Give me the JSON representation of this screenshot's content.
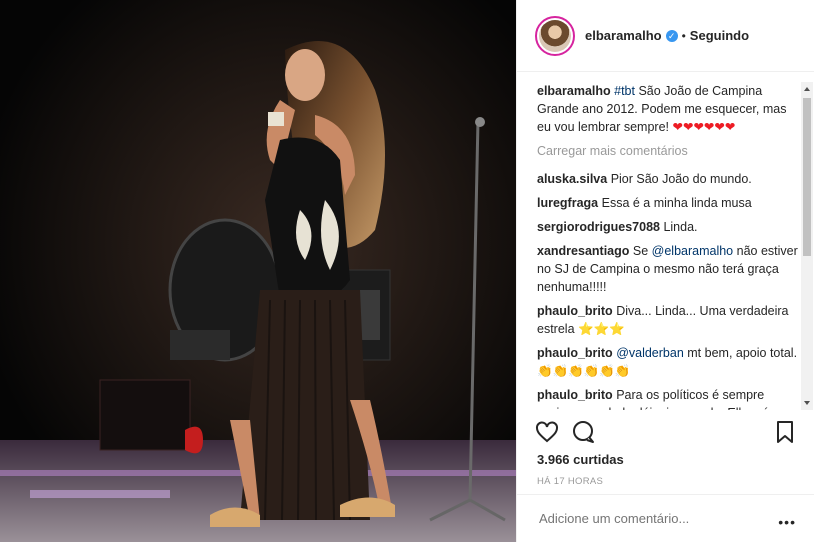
{
  "post": {
    "username": "elbaramalho",
    "verified_icon": "verified-badge-icon",
    "separator": "•",
    "follow_status": "Seguindo"
  },
  "caption": {
    "username": "elbaramalho",
    "hashtag": "#tbt",
    "text": "São João de Campina Grande ano 2012. Podem me esquecer, mas eu vou lembrar sempre!",
    "emoji": "❤❤❤❤❤❤"
  },
  "load_more": "Carregar mais comentários",
  "comments": [
    {
      "user": "aluska.silva",
      "pre": "",
      "mention": "",
      "text": "Pior São João do mundo."
    },
    {
      "user": "luregfraga",
      "pre": "",
      "mention": "",
      "text": "Essa é a minha linda musa"
    },
    {
      "user": "sergiorodrigues7088",
      "pre": "",
      "mention": "",
      "text": "Linda."
    },
    {
      "user": "xandresantiago",
      "pre": "Se",
      "mention": "@elbaramalho",
      "text": "não estiver no SJ de Campina o mesmo não terá graça nenhuma!!!!!"
    },
    {
      "user": "phaulo_brito",
      "pre": "",
      "mention": "",
      "text": "Diva... Linda... Uma verdadeira estrela ⭐⭐⭐"
    },
    {
      "user": "phaulo_brito",
      "pre": "",
      "mention": "@valderban",
      "text": "mt bem, apoio total.👏👏👏👏👏👏"
    },
    {
      "user": "phaulo_brito",
      "pre": "",
      "mention": "",
      "text": "Para os políticos é sempre assim, a verdade dói e incomoda, Elba só se pronunciou com a verdade, espero q o"
    }
  ],
  "actions": {
    "like_icon": "heart-outline-icon",
    "comment_icon": "comment-bubble-icon",
    "save_icon": "bookmark-icon"
  },
  "likes": "3.966 curtidas",
  "time": "HÁ 17 HORAS",
  "add_comment": {
    "placeholder": "Adicione um comentário...",
    "more_label": "•••"
  },
  "colors": {
    "link": "#003569",
    "verified": "#3897f0",
    "muted": "#999999",
    "story_ring": "#d6249f"
  }
}
